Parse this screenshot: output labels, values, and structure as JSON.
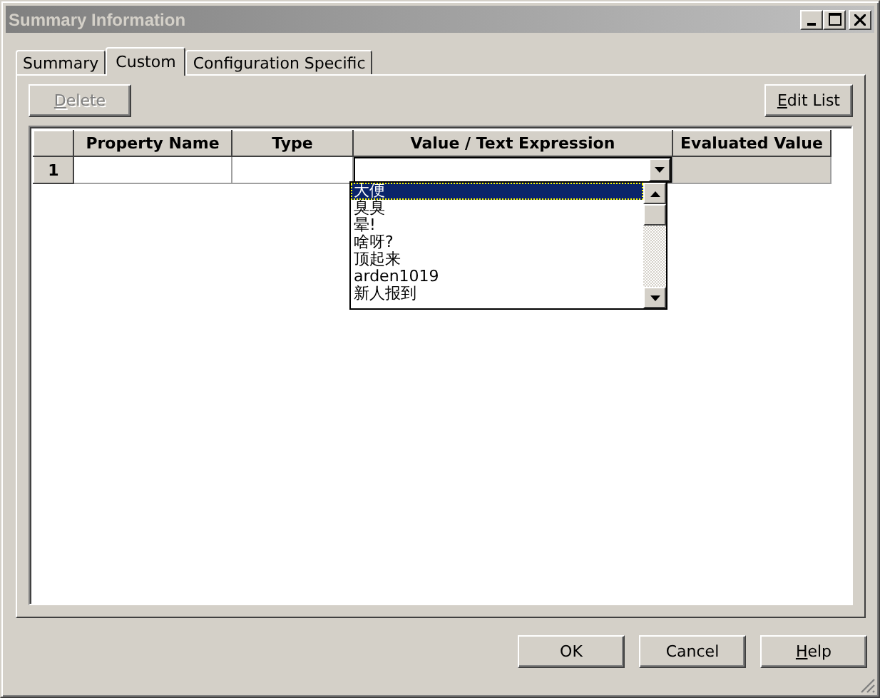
{
  "window": {
    "title": "Summary Information"
  },
  "tabs": [
    {
      "label": "Summary",
      "selected": false
    },
    {
      "label": "Custom",
      "selected": true
    },
    {
      "label": "Configuration Specific",
      "selected": false
    }
  ],
  "toolbar": [
    {
      "label": "Delete",
      "disabled": true
    },
    {
      "label": "Edit List",
      "disabled": false
    }
  ],
  "table": {
    "columns": [
      "Property Name",
      "Type",
      "Value / Text Expression",
      "Evaluated Value"
    ],
    "rows": [
      {
        "number": "1"
      }
    ]
  },
  "dropdown": {
    "items": [
      {
        "label": "大便",
        "selected": true
      },
      {
        "label": "臭臭",
        "selected": false
      },
      {
        "label": "晕!",
        "selected": false
      },
      {
        "label": "啥呀?",
        "selected": false
      },
      {
        "label": "顶起来",
        "selected": false
      },
      {
        "label": "arden1019",
        "selected": false
      },
      {
        "label": "新人报到",
        "selected": false
      }
    ]
  },
  "buttons": [
    "OK",
    "Cancel",
    "Help"
  ]
}
